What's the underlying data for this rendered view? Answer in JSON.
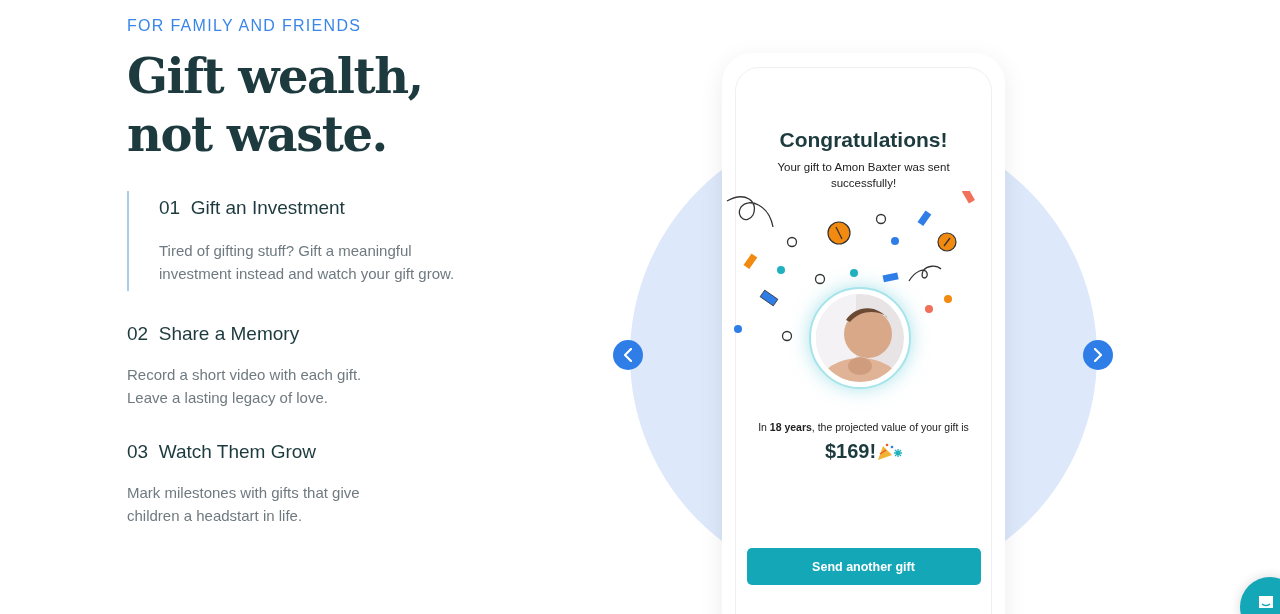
{
  "eyebrow": "FOR FAMILY AND FRIENDS",
  "headline": [
    "Gift wealth,",
    "not waste."
  ],
  "features": [
    {
      "number": "01",
      "title": "Gift an Investment",
      "selected": true,
      "lines": [
        "Tired of gifting stuff? Gift a meaningful",
        "investment instead and watch your gift grow."
      ]
    },
    {
      "number": "02",
      "title": "Share a Memory",
      "selected": false,
      "lines": [
        "Record a short video with each gift.",
        "Leave a lasting legacy of love."
      ]
    },
    {
      "number": "03",
      "title": "Watch Them Grow",
      "selected": false,
      "lines": [
        "Mark milestones with gifts that give",
        "children a headstart in life."
      ]
    }
  ],
  "phone": {
    "title": "Congratulations!",
    "subtitle": "Your gift to Amon Baxter was sent successfully!",
    "projection": "In **18 years**, the projected value of your gift is",
    "amount": "$169!",
    "button": "Send another gift"
  }
}
